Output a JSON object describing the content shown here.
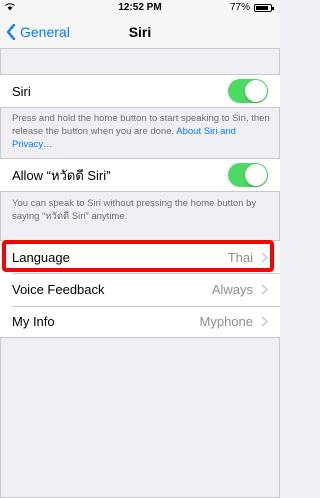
{
  "status_bar": {
    "time": "12:52 PM",
    "battery": "77%",
    "battery_level": 0.77
  },
  "nav": {
    "back_label": "General",
    "title": "Siri"
  },
  "siri": {
    "label": "Siri",
    "enabled": true
  },
  "siri_footnote": {
    "text": "Press and hold the home button to start speaking to Siri, then release the button when you are done. ",
    "link": "About Siri and Privacy…"
  },
  "allow": {
    "label": "Allow “หวัดดี Siri”",
    "enabled": true
  },
  "allow_footnote": {
    "text": "You can speak to Siri without pressing the home button by saying “หวัดดี Siri” anytime."
  },
  "settings": [
    {
      "label": "Language",
      "value": "Thai"
    },
    {
      "label": "Voice Feedback",
      "value": "Always"
    },
    {
      "label": "My Info",
      "value": "Myphone"
    }
  ],
  "colors": {
    "accent": "#007aff",
    "toggle_on": "#4cd964",
    "highlight": "#ff0000"
  }
}
